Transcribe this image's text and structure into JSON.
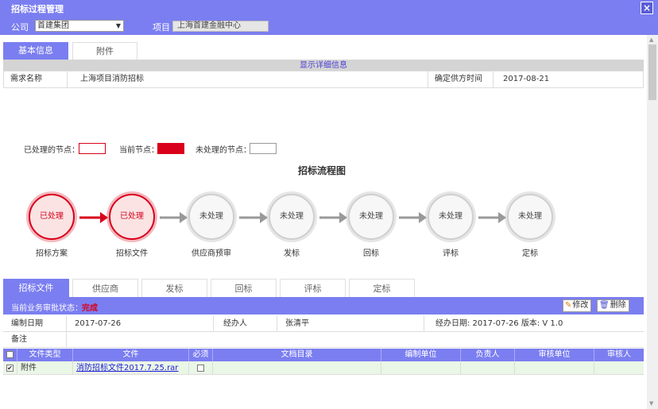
{
  "window": {
    "title": "招标过程管理",
    "close_glyph": "×"
  },
  "filters": {
    "company_label": "公司",
    "company_value": "首建集团",
    "project_label": "项目",
    "project_value": "上海首建金融中心"
  },
  "top_tabs": [
    {
      "label": "基本信息",
      "active": true
    },
    {
      "label": "附件",
      "active": false
    }
  ],
  "detail_toggle": "显示详细信息",
  "info": {
    "demand_label": "需求名称",
    "demand_value": "上海项目消防招标",
    "supplier_time_label": "确定供方时间",
    "supplier_time_value": "2017-08-21"
  },
  "legend": {
    "processed": "已处理的节点：",
    "current": "当前节点：",
    "unprocessed": "未处理的节点：",
    "colors": {
      "processed_border": "#d9001b",
      "current_fill": "#d9001b",
      "unprocessed_border": "#999999"
    }
  },
  "flow": {
    "title": "招标流程图",
    "nodes": [
      {
        "status": "已处理",
        "label": "招标方案",
        "state": "done"
      },
      {
        "status": "已处理",
        "label": "招标文件",
        "state": "done"
      },
      {
        "status": "未处理",
        "label": "供应商预审",
        "state": "todo"
      },
      {
        "status": "未处理",
        "label": "发标",
        "state": "todo"
      },
      {
        "status": "未处理",
        "label": "回标",
        "state": "todo"
      },
      {
        "status": "未处理",
        "label": "评标",
        "state": "todo"
      },
      {
        "status": "未处理",
        "label": "定标",
        "state": "todo"
      }
    ]
  },
  "bottom_tabs": [
    {
      "label": "招标文件",
      "active": true
    },
    {
      "label": "供应商",
      "active": false
    },
    {
      "label": "发标",
      "active": false
    },
    {
      "label": "回标",
      "active": false
    },
    {
      "label": "评标",
      "active": false
    },
    {
      "label": "定标",
      "active": false
    }
  ],
  "approval": {
    "label": "当前业务审批状态：",
    "status": "完成",
    "edit_label": "修改",
    "delete_label": "删除"
  },
  "meta": {
    "date_label": "编制日期",
    "date_value": "2017-07-26",
    "handler_label": "经办人",
    "handler_value": "张清平",
    "handle_info": "经办日期: 2017-07-26 版本: V 1.0",
    "remark_label": "备注"
  },
  "file_table": {
    "headers": [
      "文件类型",
      "文件",
      "必须",
      "文档目录",
      "编制单位",
      "负责人",
      "审核单位",
      "审核人"
    ],
    "rows": [
      {
        "type": "附件",
        "file": "消防招标文件2017.7.25.rar"
      }
    ]
  },
  "colors": {
    "accent": "#7b7ef0",
    "danger": "#d9001b"
  }
}
